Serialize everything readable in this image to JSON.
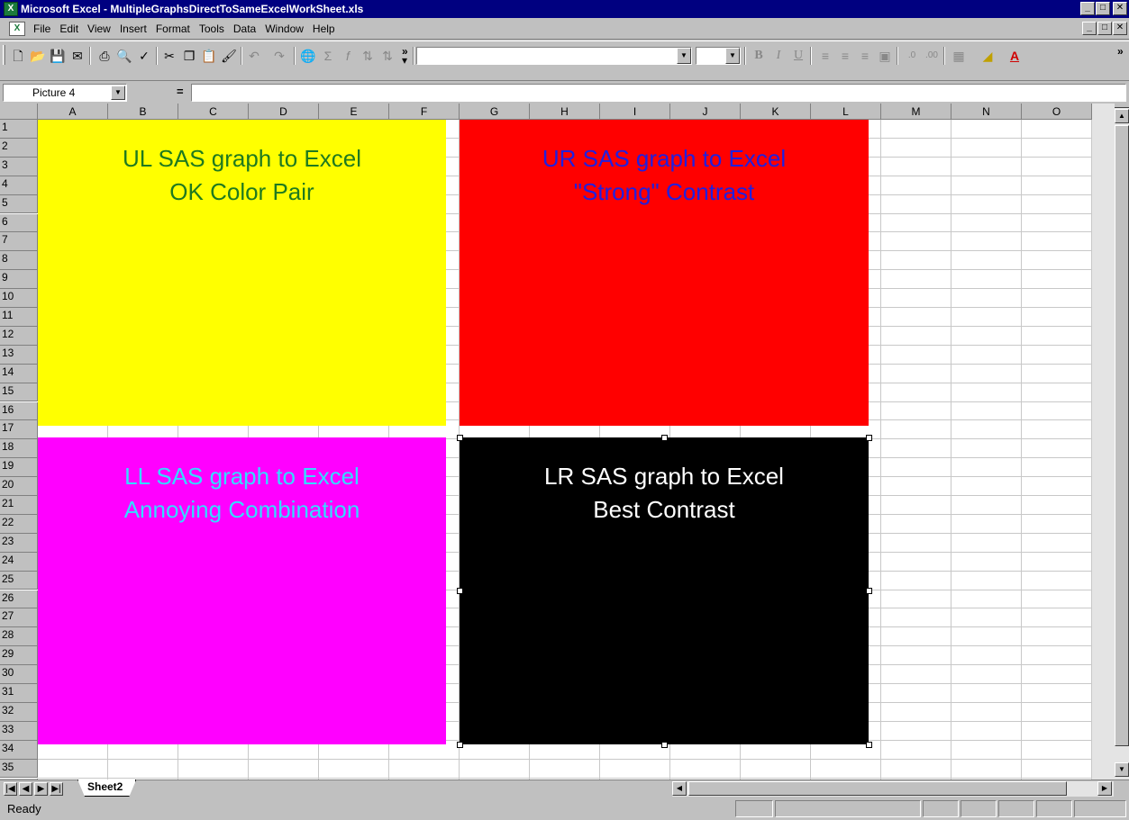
{
  "window": {
    "title": "Microsoft Excel - MultipleGraphsDirectToSameExcelWorkSheet.xls",
    "app_icon": "excel-icon"
  },
  "menu": [
    "File",
    "Edit",
    "View",
    "Insert",
    "Format",
    "Tools",
    "Data",
    "Window",
    "Help"
  ],
  "formula_bar": {
    "name_box": "Picture 4",
    "equals": "=",
    "formula": ""
  },
  "columns": [
    "A",
    "B",
    "C",
    "D",
    "E",
    "F",
    "G",
    "H",
    "I",
    "J",
    "K",
    "L",
    "M",
    "N",
    "O"
  ],
  "rows": [
    "1",
    "2",
    "3",
    "4",
    "5",
    "6",
    "7",
    "8",
    "9",
    "10",
    "11",
    "12",
    "13",
    "14",
    "15",
    "16",
    "17",
    "18",
    "19",
    "20",
    "21",
    "22",
    "23",
    "24",
    "25",
    "26",
    "27",
    "28",
    "29",
    "30",
    "31",
    "32",
    "33",
    "34",
    "35"
  ],
  "graphs": {
    "ul": {
      "line1": "UL SAS graph to Excel",
      "line2": "OK Color Pair",
      "bg": "#ffff00",
      "fg": "#1f7a1f"
    },
    "ur": {
      "line1": "UR SAS graph to Excel",
      "line2": "\"Strong\" Contrast",
      "bg": "#ff0000",
      "fg": "#2020e0"
    },
    "ll": {
      "line1": "LL SAS graph to Excel",
      "line2": "Annoying Combination",
      "bg": "#ff00ff",
      "fg": "#33ddff"
    },
    "lr": {
      "line1": "LR SAS graph to Excel",
      "line2": "Best Contrast",
      "bg": "#000000",
      "fg": "#ffffff"
    }
  },
  "sheet_tab": "Sheet2",
  "status": "Ready"
}
